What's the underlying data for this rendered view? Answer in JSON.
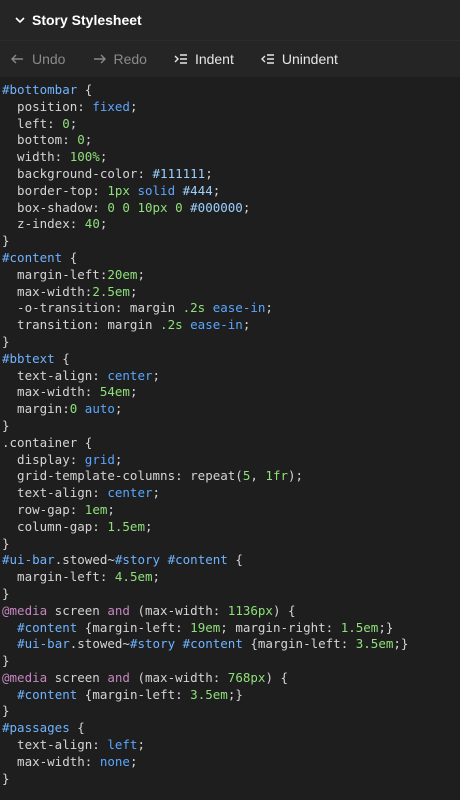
{
  "header": {
    "title": "Story Stylesheet"
  },
  "toolbar": {
    "undo_label": "Undo",
    "redo_label": "Redo",
    "indent_label": "Indent",
    "unindent_label": "Unindent"
  },
  "code_lines": [
    [
      [
        "sel",
        "#bottombar"
      ],
      [
        "punc",
        " {"
      ]
    ],
    [
      [
        "plain",
        "  position: "
      ],
      [
        "kw",
        "fixed"
      ],
      [
        "punc",
        ";"
      ]
    ],
    [
      [
        "plain",
        "  left: "
      ],
      [
        "num",
        "0"
      ],
      [
        "punc",
        ";"
      ]
    ],
    [
      [
        "plain",
        "  bottom: "
      ],
      [
        "num",
        "0"
      ],
      [
        "punc",
        ";"
      ]
    ],
    [
      [
        "plain",
        "  width: "
      ],
      [
        "num",
        "100%"
      ],
      [
        "punc",
        ";"
      ]
    ],
    [
      [
        "plain",
        "  background-color: "
      ],
      [
        "hex",
        "#111111"
      ],
      [
        "punc",
        ";"
      ]
    ],
    [
      [
        "plain",
        "  border-top: "
      ],
      [
        "num",
        "1px"
      ],
      [
        "plain",
        " "
      ],
      [
        "kw",
        "solid"
      ],
      [
        "plain",
        " "
      ],
      [
        "hex",
        "#444"
      ],
      [
        "punc",
        ";"
      ]
    ],
    [
      [
        "plain",
        "  box-shadow: "
      ],
      [
        "num",
        "0 0 10px 0"
      ],
      [
        "plain",
        " "
      ],
      [
        "hex",
        "#000000"
      ],
      [
        "punc",
        ";"
      ]
    ],
    [
      [
        "plain",
        "  z-index: "
      ],
      [
        "num",
        "40"
      ],
      [
        "punc",
        ";"
      ]
    ],
    [
      [
        "punc",
        "}"
      ]
    ],
    [
      [
        "sel",
        "#content"
      ],
      [
        "punc",
        " {"
      ]
    ],
    [
      [
        "plain",
        "  margin-left:"
      ],
      [
        "num",
        "20em"
      ],
      [
        "punc",
        ";"
      ]
    ],
    [
      [
        "plain",
        "  max-width:"
      ],
      [
        "num",
        "2.5em"
      ],
      [
        "punc",
        ";"
      ]
    ],
    [
      [
        "plain",
        "  -o-transition: margin "
      ],
      [
        "num",
        ".2s"
      ],
      [
        "plain",
        " "
      ],
      [
        "kw",
        "ease-in"
      ],
      [
        "punc",
        ";"
      ]
    ],
    [
      [
        "plain",
        "  transition: margin "
      ],
      [
        "num",
        ".2s"
      ],
      [
        "plain",
        " "
      ],
      [
        "kw",
        "ease-in"
      ],
      [
        "punc",
        ";"
      ]
    ],
    [
      [
        "punc",
        "}"
      ]
    ],
    [
      [
        "sel",
        "#bbtext"
      ],
      [
        "punc",
        " {"
      ]
    ],
    [
      [
        "plain",
        "  text-align: "
      ],
      [
        "kw",
        "center"
      ],
      [
        "punc",
        ";"
      ]
    ],
    [
      [
        "plain",
        "  max-width: "
      ],
      [
        "num",
        "54em"
      ],
      [
        "punc",
        ";"
      ]
    ],
    [
      [
        "plain",
        "  margin:"
      ],
      [
        "num",
        "0"
      ],
      [
        "plain",
        " "
      ],
      [
        "kw",
        "auto"
      ],
      [
        "punc",
        ";"
      ]
    ],
    [
      [
        "punc",
        "}"
      ]
    ],
    [
      [
        "plain",
        ".container {"
      ]
    ],
    [
      [
        "plain",
        "  display: "
      ],
      [
        "kw",
        "grid"
      ],
      [
        "punc",
        ";"
      ]
    ],
    [
      [
        "plain",
        "  grid-template-columns: repeat("
      ],
      [
        "num",
        "5"
      ],
      [
        "plain",
        ", "
      ],
      [
        "num",
        "1fr"
      ],
      [
        "plain",
        ");"
      ]
    ],
    [
      [
        "plain",
        "  text-align: "
      ],
      [
        "kw",
        "center"
      ],
      [
        "punc",
        ";"
      ]
    ],
    [
      [
        "plain",
        "  row-gap: "
      ],
      [
        "num",
        "1em"
      ],
      [
        "punc",
        ";"
      ]
    ],
    [
      [
        "plain",
        "  column-gap: "
      ],
      [
        "num",
        "1.5em"
      ],
      [
        "punc",
        ";"
      ]
    ],
    [
      [
        "punc",
        "}"
      ]
    ],
    [
      [
        "sel",
        "#ui-bar"
      ],
      [
        "plain",
        ".stowed~"
      ],
      [
        "sel",
        "#story #content"
      ],
      [
        "punc",
        " {"
      ]
    ],
    [
      [
        "plain",
        "  margin-left: "
      ],
      [
        "num",
        "4.5em"
      ],
      [
        "punc",
        ";"
      ]
    ],
    [
      [
        "punc",
        "}"
      ]
    ],
    [
      [
        "at",
        "@media"
      ],
      [
        "plain",
        " screen "
      ],
      [
        "at",
        "and"
      ],
      [
        "plain",
        " (max-width: "
      ],
      [
        "num",
        "1136px"
      ],
      [
        "plain",
        ") {"
      ]
    ],
    [
      [
        "plain",
        "  "
      ],
      [
        "sel",
        "#content"
      ],
      [
        "plain",
        " {margin-left: "
      ],
      [
        "num",
        "19em"
      ],
      [
        "plain",
        "; margin-right: "
      ],
      [
        "num",
        "1.5em"
      ],
      [
        "plain",
        ";}"
      ]
    ],
    [
      [
        "plain",
        "  "
      ],
      [
        "sel",
        "#ui-bar"
      ],
      [
        "plain",
        ".stowed~"
      ],
      [
        "sel",
        "#story #content"
      ],
      [
        "plain",
        " {margin-left: "
      ],
      [
        "num",
        "3.5em"
      ],
      [
        "plain",
        ";}"
      ]
    ],
    [
      [
        "punc",
        "}"
      ]
    ],
    [
      [
        "at",
        "@media"
      ],
      [
        "plain",
        " screen "
      ],
      [
        "at",
        "and"
      ],
      [
        "plain",
        " (max-width: "
      ],
      [
        "num",
        "768px"
      ],
      [
        "plain",
        ") {"
      ]
    ],
    [
      [
        "plain",
        "  "
      ],
      [
        "sel",
        "#content"
      ],
      [
        "plain",
        " {margin-left: "
      ],
      [
        "num",
        "3.5em"
      ],
      [
        "plain",
        ";}"
      ]
    ],
    [
      [
        "punc",
        "}"
      ]
    ],
    [
      [
        "sel",
        "#passages"
      ],
      [
        "punc",
        " {"
      ]
    ],
    [
      [
        "plain",
        "  text-align: "
      ],
      [
        "kw",
        "left"
      ],
      [
        "punc",
        ";"
      ]
    ],
    [
      [
        "plain",
        "  max-width: "
      ],
      [
        "kw",
        "none"
      ],
      [
        "punc",
        ";"
      ]
    ],
    [
      [
        "punc",
        "}"
      ]
    ]
  ]
}
